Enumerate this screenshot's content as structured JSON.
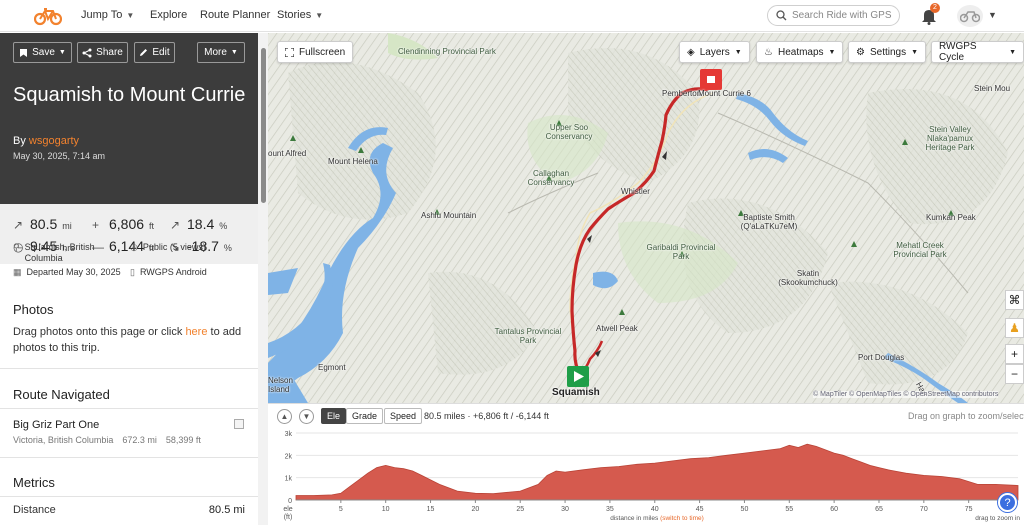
{
  "nav": {
    "jump_to": "Jump To",
    "explore": "Explore",
    "route_planner": "Route Planner",
    "stories": "Stories",
    "search_placeholder": "Search Ride with GPS",
    "notification_count": "2"
  },
  "actions": {
    "save": "Save",
    "share": "Share",
    "edit": "Edit",
    "more": "More"
  },
  "ride": {
    "title": "Squamish to Mount Currie",
    "by_prefix": "By",
    "author": "wsgogarty",
    "date": "May 30, 2025, 7:14 am"
  },
  "stats": {
    "distance": "80.5",
    "distance_unit": "mi",
    "elev_gain": "6,806",
    "elev_gain_unit": "ft",
    "max_grade": "18.4",
    "max_grade_unit": "%",
    "moving_time": "9:45",
    "moving_time_unit": "hrs",
    "elev_loss": "6,144",
    "elev_loss_unit": "ft",
    "min_grade": "-18.7",
    "min_grade_unit": "%"
  },
  "details": {
    "location": "Squamish, British Columbia",
    "privacy": "Public (5 views)",
    "departed": "Departed May 30, 2025",
    "device": "RWGPS Android"
  },
  "photos": {
    "heading": "Photos",
    "text_before": "Drag photos onto this page or click",
    "link": "here",
    "text_after": "to add photos to this trip."
  },
  "route_navigated": {
    "heading": "Route Navigated",
    "name": "Big Griz Part One",
    "location": "Victoria, British Columbia",
    "distance": "672.3 mi",
    "elevation": "58,399 ft"
  },
  "metrics": {
    "heading": "Metrics",
    "distance_label": "Distance",
    "distance_value": "80.5 mi"
  },
  "map": {
    "fullscreen": "Fullscreen",
    "layers": "Layers",
    "heatmaps": "Heatmaps",
    "settings": "Settings",
    "map_style": "RWGPS Cycle",
    "attribution": "© MapTiler © OpenMapTiles © OpenStreetMap contributors",
    "labels": [
      {
        "name": "clendinning",
        "text": "Clendinning Provincial Park"
      },
      {
        "name": "upper-soo",
        "text": "Upper Soo Conservancy"
      },
      {
        "name": "callaghan",
        "text": "Callaghan Conservancy"
      },
      {
        "name": "garibaldi",
        "text": "Garibaldi Provincial Park"
      },
      {
        "name": "tantalus",
        "text": "Tantalus Provincial Park"
      },
      {
        "name": "stein-valley",
        "text": "Stein Valley Nlaka'pamux Heritage Park"
      },
      {
        "name": "mehatl",
        "text": "Mehatl Creek Provincial Park"
      },
      {
        "name": "mount-alfred",
        "text": "ount Alfred"
      },
      {
        "name": "mount-helena",
        "text": "Mount Helena"
      },
      {
        "name": "ashlu",
        "text": "Ashlu Mountain"
      },
      {
        "name": "whistler",
        "text": "Whistler"
      },
      {
        "name": "baptiste",
        "text": "Baptiste Smith (Q'aLaTKu7eM)"
      },
      {
        "name": "kumkan",
        "text": "Kumkan Peak"
      },
      {
        "name": "skatin",
        "text": "Skatin (Skookumchuck)"
      },
      {
        "name": "atwell",
        "text": "Atwell Peak"
      },
      {
        "name": "egmont",
        "text": "Egmont"
      },
      {
        "name": "nelson-island",
        "text": "Nelson Island"
      },
      {
        "name": "squamish",
        "text": "Squamish"
      },
      {
        "name": "port-douglas",
        "text": "Port Douglas"
      },
      {
        "name": "pemberton",
        "text": "Pemberton"
      },
      {
        "name": "mount-currie",
        "text": "Mount Currie 6"
      },
      {
        "name": "stein-mountain",
        "text": "Stein Mou"
      },
      {
        "name": "harrison",
        "text": "Harr"
      }
    ]
  },
  "profile": {
    "tab_ele": "Ele",
    "tab_grade": "Grade",
    "tab_speed": "Speed",
    "summary": "80.5 miles · +6,806 ft / -6,144 ft",
    "hint": "Drag on graph to zoom/select",
    "y_axis_unit_1": "ele",
    "y_axis_unit_2": "(ft)",
    "x_axis_label": "distance in miles",
    "x_axis_link": "(switch to time)",
    "drag_hint": "drag to zoom in",
    "color": "#d55a4e"
  },
  "chart_data": {
    "type": "area",
    "title": "",
    "xlabel": "distance in miles",
    "ylabel": "ele (ft)",
    "xlim": [
      0,
      80.5
    ],
    "ylim": [
      0,
      3000
    ],
    "x_ticks": [
      5,
      10,
      15,
      20,
      25,
      30,
      35,
      40,
      45,
      50,
      55,
      60,
      65,
      70,
      75
    ],
    "y_ticks": [
      {
        "v": 0,
        "label": "0"
      },
      {
        "v": 1000,
        "label": "1k"
      },
      {
        "v": 2000,
        "label": "2k"
      },
      {
        "v": 3000,
        "label": "3k"
      }
    ],
    "series": [
      {
        "x": [
          0,
          2,
          4,
          5,
          6,
          7,
          8,
          9,
          10,
          11,
          12,
          13,
          14,
          15,
          16,
          17,
          18,
          20,
          22,
          25,
          27,
          28,
          29,
          30,
          32,
          34,
          36,
          38,
          40,
          42,
          44,
          46,
          48,
          50,
          52,
          54,
          55,
          56,
          57,
          58,
          59,
          60,
          61,
          62,
          63,
          64,
          65,
          66,
          68,
          70,
          72,
          74,
          76,
          78,
          80.5
        ],
        "y": [
          200,
          200,
          230,
          300,
          600,
          900,
          1200,
          1450,
          1550,
          1450,
          1400,
          1300,
          1100,
          900,
          700,
          550,
          400,
          300,
          280,
          400,
          700,
          1100,
          1300,
          1250,
          1350,
          1450,
          1500,
          1600,
          1650,
          1750,
          1850,
          1900,
          2000,
          2100,
          2200,
          2300,
          2450,
          2350,
          2500,
          2400,
          2250,
          2100,
          2000,
          1850,
          1700,
          1550,
          1450,
          1350,
          1200,
          1100,
          1050,
          950,
          700,
          700,
          650
        ]
      }
    ]
  }
}
